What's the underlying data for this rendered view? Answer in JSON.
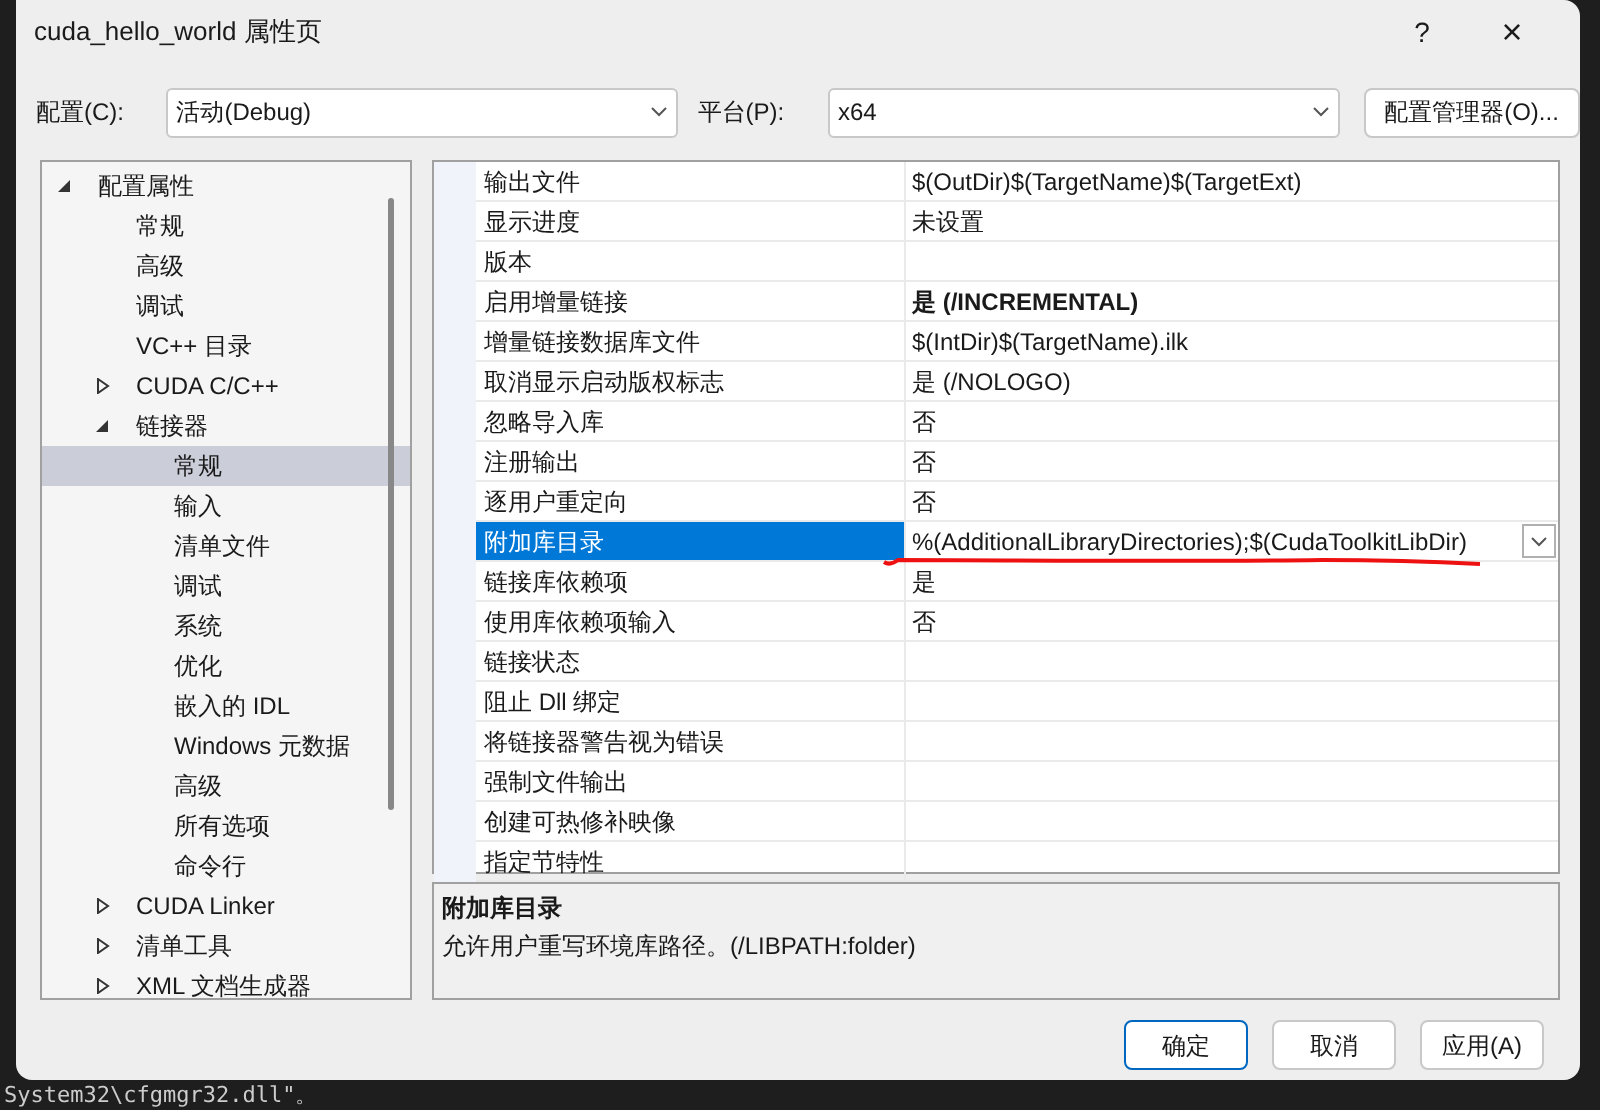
{
  "window": {
    "title": "cuda_hello_world 属性页",
    "help": "?",
    "close": "×"
  },
  "config": {
    "label": "配置(C):",
    "value": "活动(Debug)"
  },
  "platform": {
    "label": "平台(P):",
    "value": "x64"
  },
  "config_manager": "配置管理器(O)...",
  "tree": [
    {
      "label": "配置属性",
      "expanded": true,
      "selected": false,
      "children": [
        {
          "label": "常规",
          "selected": false
        },
        {
          "label": "高级",
          "selected": false
        },
        {
          "label": "调试",
          "selected": false
        },
        {
          "label": "VC++ 目录",
          "selected": false
        },
        {
          "label": "CUDA C/C++",
          "expanded": false,
          "selected": false
        },
        {
          "label": "链接器",
          "expanded": true,
          "selected": false,
          "children": [
            {
              "label": "常规",
              "selected": true
            },
            {
              "label": "输入",
              "selected": false
            },
            {
              "label": "清单文件",
              "selected": false
            },
            {
              "label": "调试",
              "selected": false
            },
            {
              "label": "系统",
              "selected": false
            },
            {
              "label": "优化",
              "selected": false
            },
            {
              "label": "嵌入的 IDL",
              "selected": false
            },
            {
              "label": "Windows 元数据",
              "selected": false
            },
            {
              "label": "高级",
              "selected": false
            },
            {
              "label": "所有选项",
              "selected": false
            },
            {
              "label": "命令行",
              "selected": false
            }
          ]
        },
        {
          "label": "CUDA Linker",
          "expanded": false,
          "selected": false
        },
        {
          "label": "清单工具",
          "expanded": false,
          "selected": false
        },
        {
          "label": "XML 文档生成器",
          "expanded": false,
          "selected": false
        }
      ]
    }
  ],
  "properties": [
    {
      "name": "输出文件",
      "value": "$(OutDir)$(TargetName)$(TargetExt)",
      "modified": false,
      "selected": false
    },
    {
      "name": "显示进度",
      "value": "未设置",
      "modified": false,
      "selected": false
    },
    {
      "name": "版本",
      "selected": false
    },
    {
      "name": "启用增量链接",
      "value": "是 (/INCREMENTAL)",
      "modified": true,
      "selected": false
    },
    {
      "name": "增量链接数据库文件",
      "value": "$(IntDir)$(TargetName).ilk",
      "modified": false,
      "selected": false
    },
    {
      "name": "取消显示启动版权标志",
      "value": "是 (/NOLOGO)",
      "modified": false,
      "selected": false
    },
    {
      "name": "忽略导入库",
      "value": "否",
      "modified": false,
      "selected": false
    },
    {
      "name": "注册输出",
      "value": "否",
      "modified": false,
      "selected": false
    },
    {
      "name": "逐用户重定向",
      "value": "否",
      "modified": false,
      "selected": false
    },
    {
      "name": "附加库目录",
      "value": "%(AdditionalLibraryDirectories);$(CudaToolkitLibDir)",
      "modified": false,
      "selected": true
    },
    {
      "name": "链接库依赖项",
      "value": "是",
      "modified": false,
      "selected": false
    },
    {
      "name": "使用库依赖项输入",
      "value": "否",
      "modified": false,
      "selected": false
    },
    {
      "name": "链接状态",
      "selected": false
    },
    {
      "name": "阻止 Dll 绑定",
      "selected": false
    },
    {
      "name": "将链接器警告视为错误",
      "selected": false
    },
    {
      "name": "强制文件输出",
      "selected": false
    },
    {
      "name": "创建可热修补映像",
      "selected": false
    },
    {
      "name": "指定节特性",
      "selected": false
    }
  ],
  "description": {
    "title": "附加库目录",
    "text": "允许用户重写环境库路径。(/LIBPATH:folder)"
  },
  "buttons": [
    {
      "label": "确定",
      "default": true
    },
    {
      "label": "取消",
      "default": false
    },
    {
      "label": "应用(A)",
      "default": false
    }
  ],
  "console_line": "System32\\cfgmgr32.dll\"。"
}
